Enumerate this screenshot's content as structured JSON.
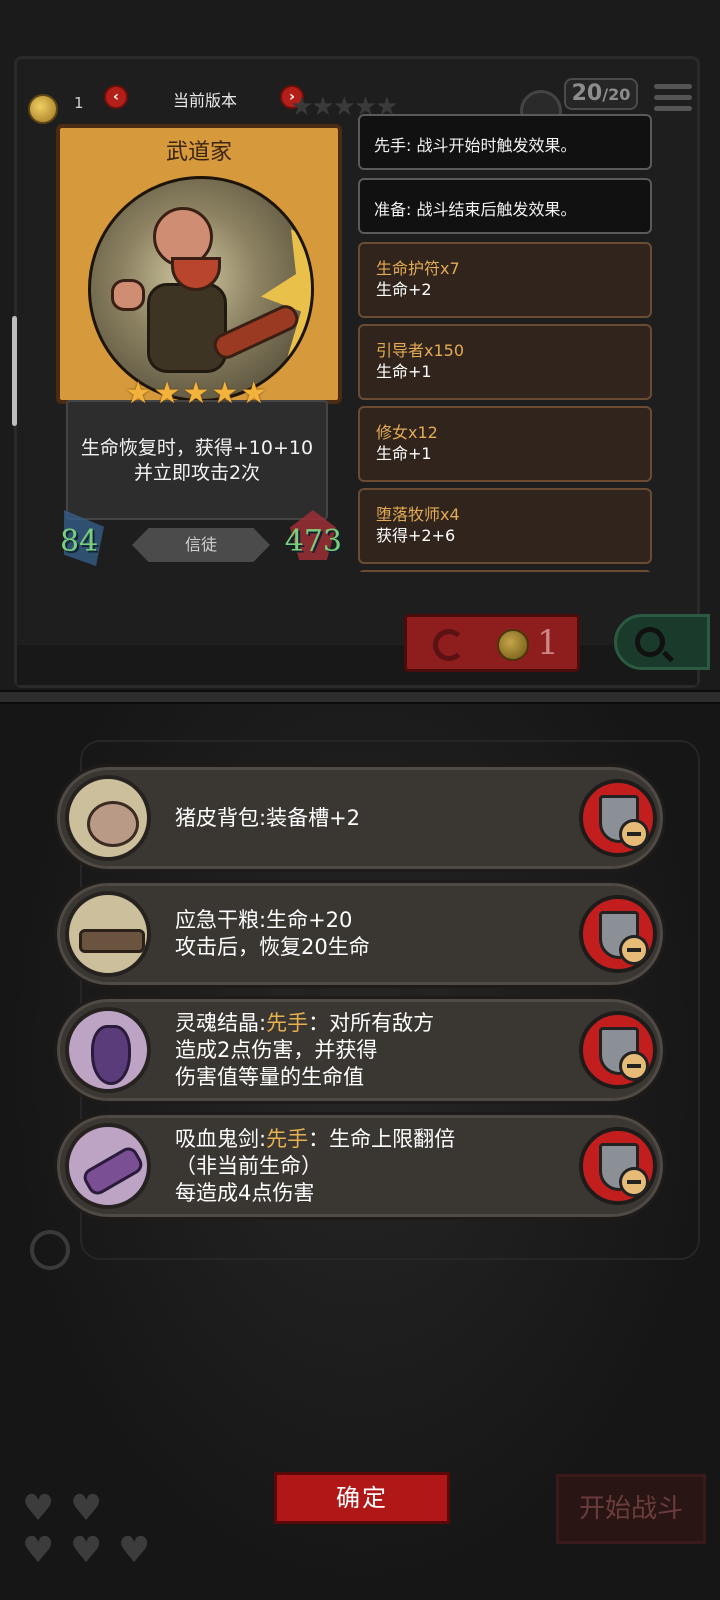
{
  "header": {
    "coin_count": "1",
    "version_label": "当前版本",
    "prev_arrow": "‹",
    "next_arrow": "›",
    "level_current": "20",
    "level_max": "/20"
  },
  "card": {
    "name": "武道家",
    "stars": "★★★★★",
    "star_count": 5,
    "desc_line1": "生命恢复时，获得+10+10",
    "desc_line2": "并立即攻击2次",
    "attack": "84",
    "health": "473",
    "class": "信徒"
  },
  "synergies": {
    "keyword_first": "先手: 战斗开始时触发效果。",
    "keyword_prepare": "准备: 战斗结束后触发效果。",
    "items": [
      {
        "name": "生命护符x7",
        "effect": "生命+2"
      },
      {
        "name": "引导者x150",
        "effect": "生命+1"
      },
      {
        "name": "修女x12",
        "effect": "生命+1"
      },
      {
        "name": "堕落牧师x4",
        "effect": "获得+2+6"
      }
    ]
  },
  "refresh": {
    "cost": "1"
  },
  "equipment": [
    {
      "name": "猪皮背包",
      "sep": ":",
      "line1": "装备槽+2",
      "line2": "",
      "line3": ""
    },
    {
      "name": "应急干粮",
      "sep": ":",
      "line1": "生命+20",
      "line2": "攻击后，恢复20生命",
      "line3": ""
    },
    {
      "name": "灵魂结晶",
      "sep": ":",
      "keyword": "先手",
      "line1": "：对所有敌方",
      "line2": "造成2点伤害，并获得",
      "line3": "伤害值等量的生命值"
    },
    {
      "name": "吸血鬼剑",
      "sep": ":",
      "keyword": "先手",
      "line1": "：生命上限翻倍",
      "line2": "（非当前生命）",
      "line3": "每造成4点伤害"
    }
  ],
  "buttons": {
    "confirm": "确定",
    "start_battle": "开始战斗"
  },
  "lives": {
    "hearts": "♥",
    "count": 5
  },
  "colors": {
    "accent_red": "#b01818",
    "keyword_gold": "#e8b04f",
    "stat_green": "#7ad07a",
    "card_frame": "#d69a3c"
  },
  "icons": {
    "coin": "coin-icon",
    "refresh": "refresh-icon",
    "search": "search-icon",
    "remove": "shield-minus-icon",
    "menu": "menu-icon",
    "heart": "heart-icon"
  }
}
